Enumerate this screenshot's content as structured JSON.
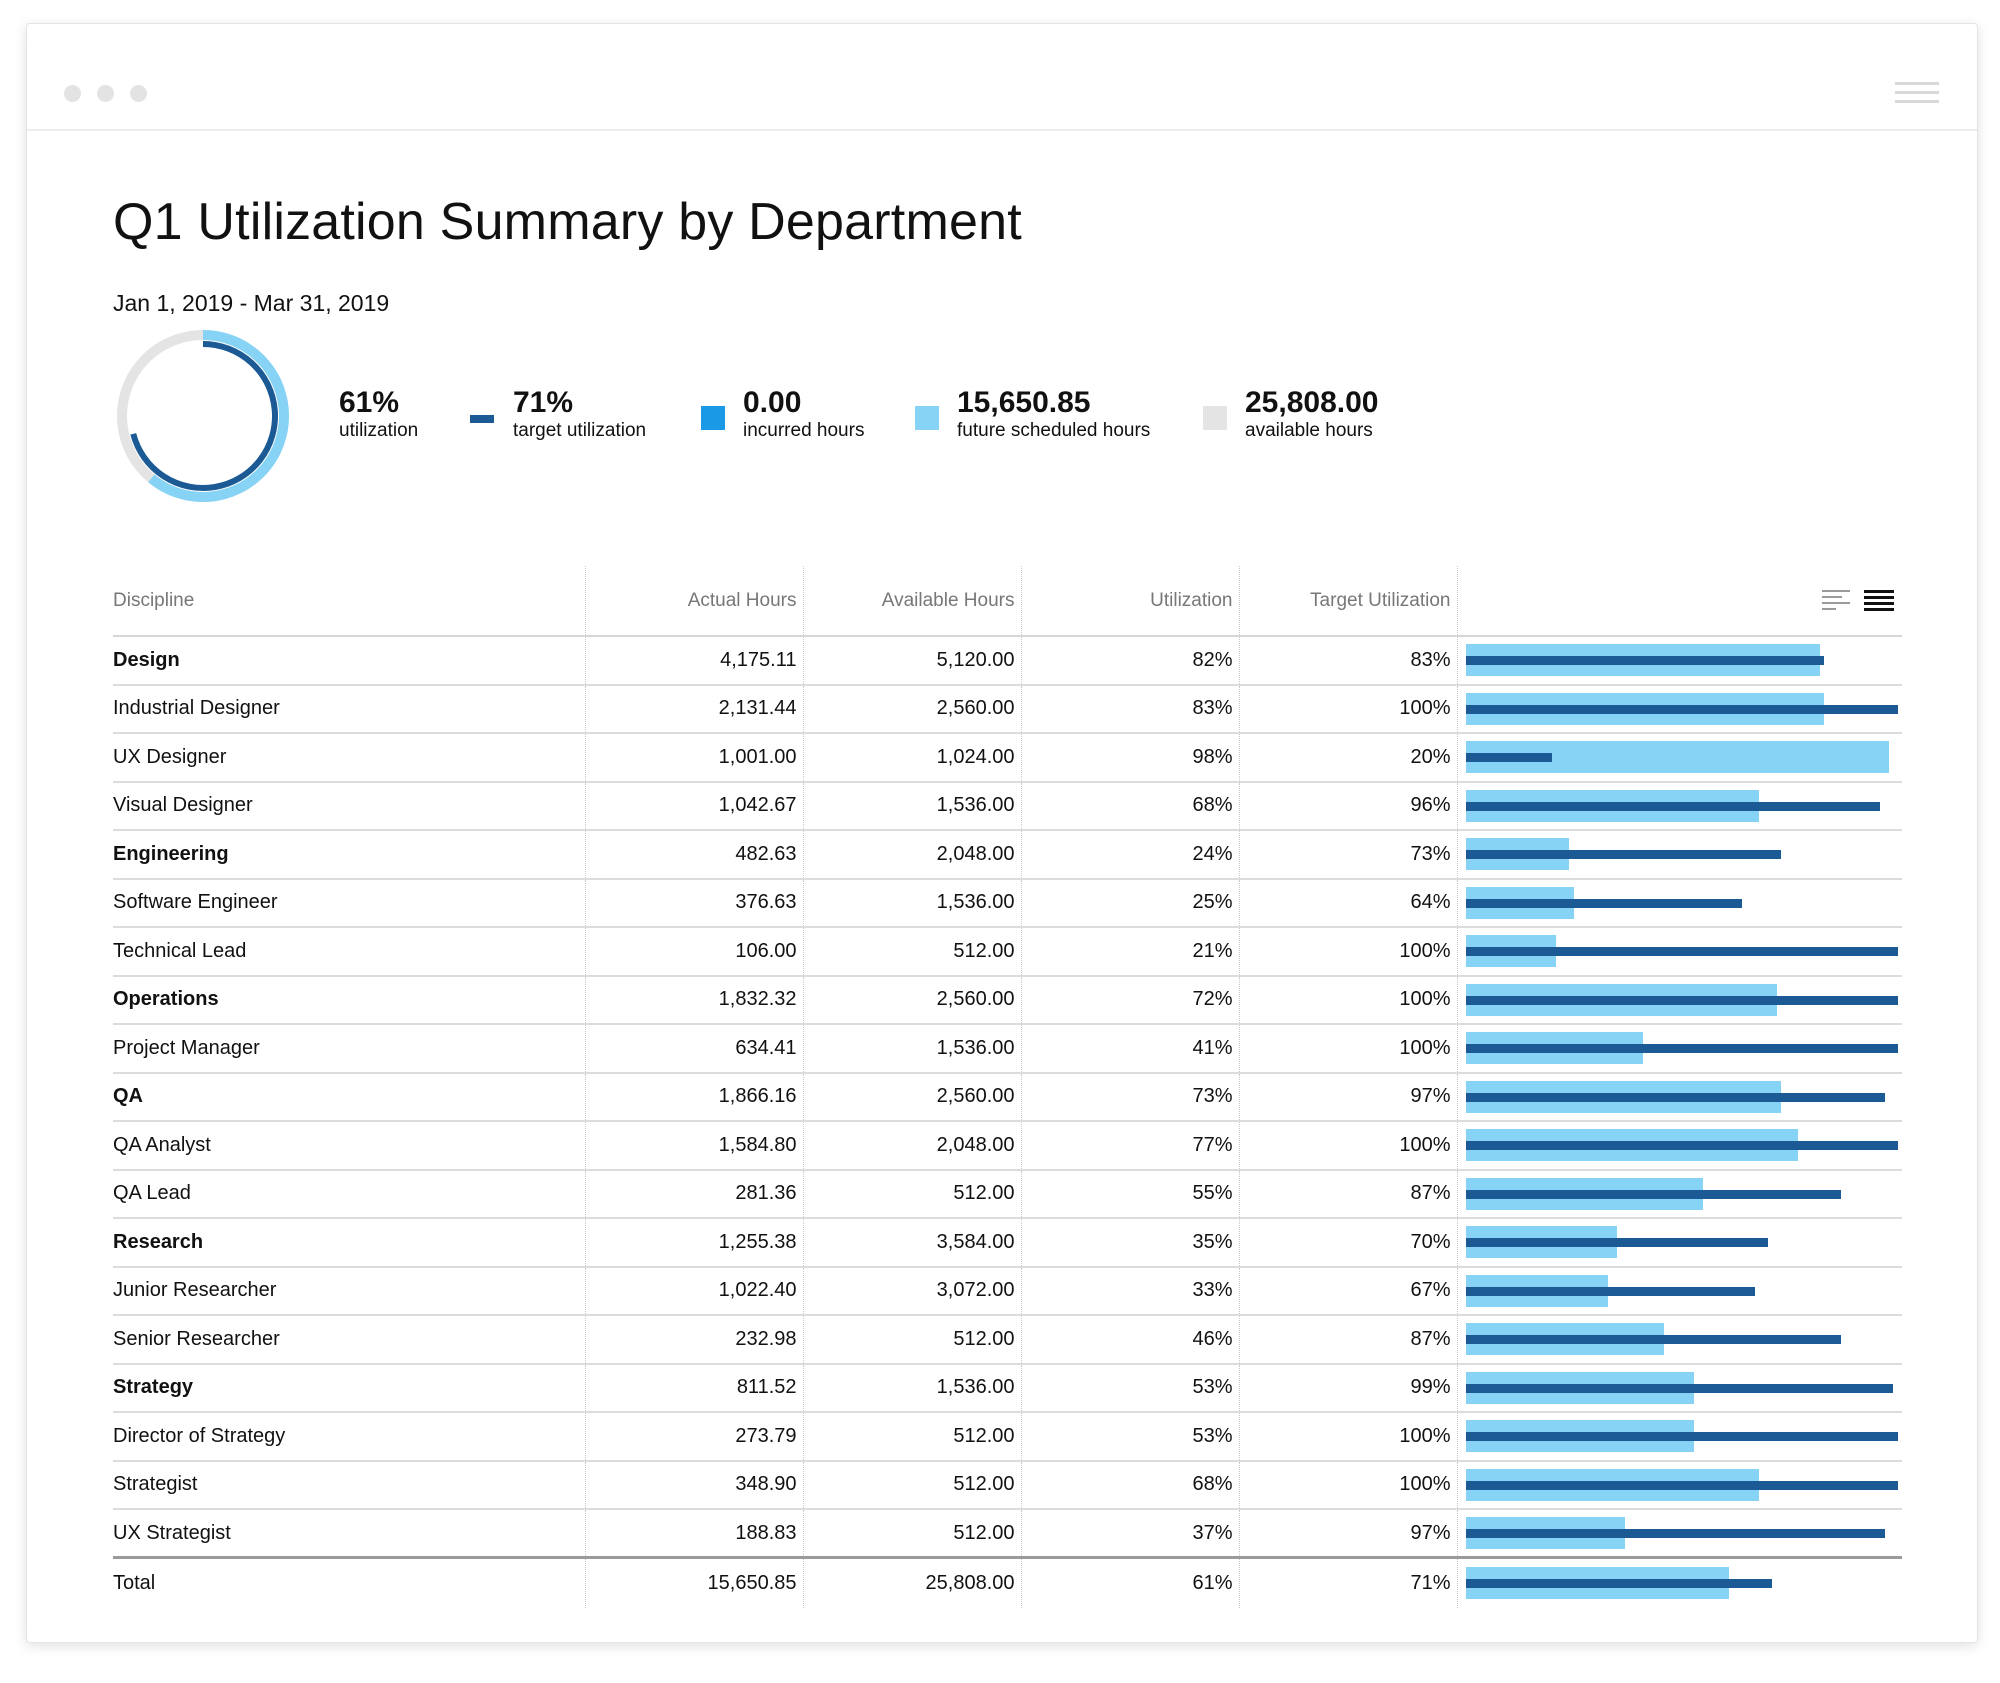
{
  "title": "Q1 Utilization Summary by Department",
  "date_range": "Jan 1, 2019 - Mar 31, 2019",
  "colors": {
    "actual": "#86d3f5",
    "target": "#1b5a94",
    "incurred": "#1a9ae6",
    "future": "#86d3f5",
    "available": "#e4e4e4"
  },
  "donut": {
    "utilization": 0.61,
    "target": 0.71
  },
  "kpis": [
    {
      "value": "61%",
      "label": "utilization"
    },
    {
      "value": "71%",
      "label": "target utilization"
    },
    {
      "value": "0.00",
      "label": "incurred hours"
    },
    {
      "value": "15,650.85",
      "label": "future scheduled hours"
    },
    {
      "value": "25,808.00",
      "label": "available hours"
    }
  ],
  "table": {
    "headers": {
      "discipline": "Discipline",
      "actual": "Actual Hours",
      "available": "Available Hours",
      "utilization": "Utilization",
      "target": "Target Utilization"
    },
    "rows": [
      {
        "name": "Design",
        "group": true,
        "actual": "4,175.11",
        "available": "5,120.00",
        "util": "82%",
        "target": "83%",
        "util_v": 0.82,
        "target_v": 0.83
      },
      {
        "name": "Industrial Designer",
        "group": false,
        "actual": "2,131.44",
        "available": "2,560.00",
        "util": "83%",
        "target": "100%",
        "util_v": 0.83,
        "target_v": 1.0
      },
      {
        "name": "UX Designer",
        "group": false,
        "actual": "1,001.00",
        "available": "1,024.00",
        "util": "98%",
        "target": "20%",
        "util_v": 0.98,
        "target_v": 0.2
      },
      {
        "name": "Visual Designer",
        "group": false,
        "actual": "1,042.67",
        "available": "1,536.00",
        "util": "68%",
        "target": "96%",
        "util_v": 0.68,
        "target_v": 0.96
      },
      {
        "name": "Engineering",
        "group": true,
        "actual": "482.63",
        "available": "2,048.00",
        "util": "24%",
        "target": "73%",
        "util_v": 0.24,
        "target_v": 0.73
      },
      {
        "name": "Software Engineer",
        "group": false,
        "actual": "376.63",
        "available": "1,536.00",
        "util": "25%",
        "target": "64%",
        "util_v": 0.25,
        "target_v": 0.64
      },
      {
        "name": "Technical Lead",
        "group": false,
        "actual": "106.00",
        "available": "512.00",
        "util": "21%",
        "target": "100%",
        "util_v": 0.21,
        "target_v": 1.0
      },
      {
        "name": "Operations",
        "group": true,
        "actual": "1,832.32",
        "available": "2,560.00",
        "util": "72%",
        "target": "100%",
        "util_v": 0.72,
        "target_v": 1.0
      },
      {
        "name": "Project Manager",
        "group": false,
        "actual": "634.41",
        "available": "1,536.00",
        "util": "41%",
        "target": "100%",
        "util_v": 0.41,
        "target_v": 1.0
      },
      {
        "name": "QA",
        "group": true,
        "actual": "1,866.16",
        "available": "2,560.00",
        "util": "73%",
        "target": "97%",
        "util_v": 0.73,
        "target_v": 0.97
      },
      {
        "name": "QA Analyst",
        "group": false,
        "actual": "1,584.80",
        "available": "2,048.00",
        "util": "77%",
        "target": "100%",
        "util_v": 0.77,
        "target_v": 1.0
      },
      {
        "name": "QA Lead",
        "group": false,
        "actual": "281.36",
        "available": "512.00",
        "util": "55%",
        "target": "87%",
        "util_v": 0.55,
        "target_v": 0.87
      },
      {
        "name": "Research",
        "group": true,
        "actual": "1,255.38",
        "available": "3,584.00",
        "util": "35%",
        "target": "70%",
        "util_v": 0.35,
        "target_v": 0.7
      },
      {
        "name": "Junior Researcher",
        "group": false,
        "actual": "1,022.40",
        "available": "3,072.00",
        "util": "33%",
        "target": "67%",
        "util_v": 0.33,
        "target_v": 0.67
      },
      {
        "name": "Senior Researcher",
        "group": false,
        "actual": "232.98",
        "available": "512.00",
        "util": "46%",
        "target": "87%",
        "util_v": 0.46,
        "target_v": 0.87
      },
      {
        "name": "Strategy",
        "group": true,
        "actual": "811.52",
        "available": "1,536.00",
        "util": "53%",
        "target": "99%",
        "util_v": 0.53,
        "target_v": 0.99
      },
      {
        "name": "Director of Strategy",
        "group": false,
        "actual": "273.79",
        "available": "512.00",
        "util": "53%",
        "target": "100%",
        "util_v": 0.53,
        "target_v": 1.0
      },
      {
        "name": "Strategist",
        "group": false,
        "actual": "348.90",
        "available": "512.00",
        "util": "68%",
        "target": "100%",
        "util_v": 0.68,
        "target_v": 1.0
      },
      {
        "name": "UX Strategist",
        "group": false,
        "actual": "188.83",
        "available": "512.00",
        "util": "37%",
        "target": "97%",
        "util_v": 0.37,
        "target_v": 0.97
      }
    ],
    "total": {
      "name": "Total",
      "actual": "15,650.85",
      "available": "25,808.00",
      "util": "61%",
      "target": "71%",
      "util_v": 0.61,
      "target_v": 0.71
    }
  }
}
